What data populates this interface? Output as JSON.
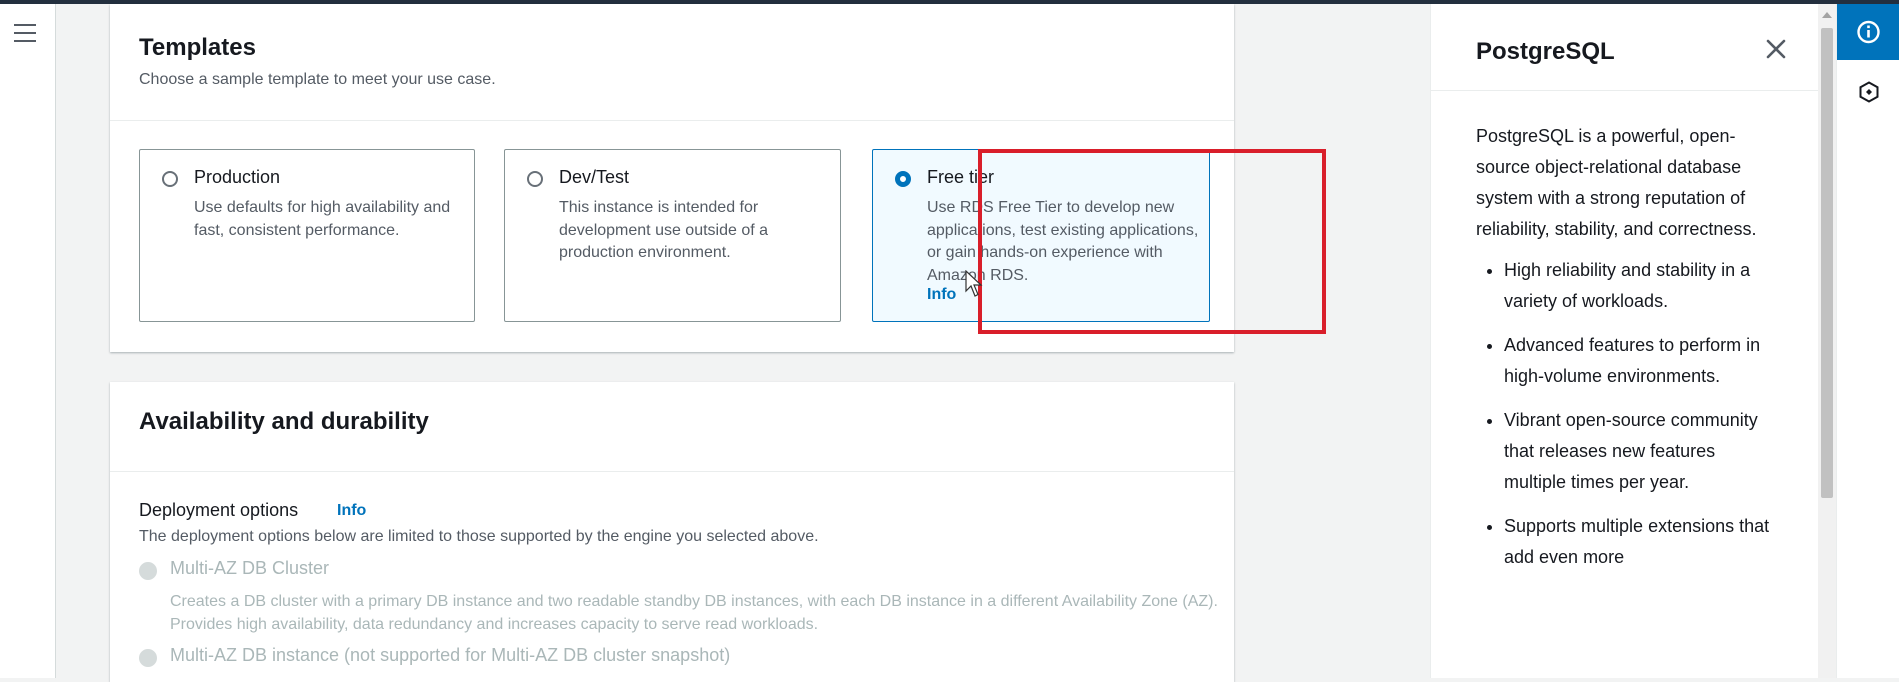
{
  "templates": {
    "title": "Templates",
    "description": "Choose a sample template to meet your use case.",
    "options": [
      {
        "title": "Production",
        "description": "Use defaults for high availability and fast, consistent performance.",
        "selected": false
      },
      {
        "title": "Dev/Test",
        "description": "This instance is intended for development use outside of a production environment.",
        "selected": false
      },
      {
        "title": "Free tier",
        "description": "Use RDS Free Tier to develop new applications, test existing applications, or gain hands-on experience with Amazon RDS.",
        "info": "Info",
        "selected": true
      }
    ]
  },
  "availability": {
    "title": "Availability and durability",
    "deployment_label": "Deployment options",
    "deployment_info": "Info",
    "deployment_desc": "The deployment options below are limited to those supported by the engine you selected above.",
    "options": [
      {
        "title": "Multi-AZ DB Cluster",
        "description": "Creates a DB cluster with a primary DB instance and two readable standby DB instances, with each DB instance in a different Availability Zone (AZ). Provides high availability, data redundancy and increases capacity to serve read workloads.",
        "disabled": true
      },
      {
        "title": "Multi-AZ DB instance (not supported for Multi-AZ DB cluster snapshot)",
        "disabled": true
      }
    ]
  },
  "help_panel": {
    "title": "PostgreSQL",
    "intro": "PostgreSQL is a powerful, open-source object-relational database system with a strong reputation of reliability, stability, and correctness.",
    "bullets": [
      "High reliability and stability in a variety of workloads.",
      "Advanced features to perform in high-volume environments.",
      "Vibrant open-source community that releases new features multiple times per year.",
      "Supports multiple extensions that add even more"
    ]
  },
  "icons": {
    "menu": "hamburger-icon",
    "close": "close-icon",
    "info_tab": "info-circle-icon",
    "secondary_tab": "hexagon-icon"
  },
  "colors": {
    "accent": "#0073bb",
    "highlight": "#d91e2a",
    "disabled_text": "#aab7b8"
  }
}
